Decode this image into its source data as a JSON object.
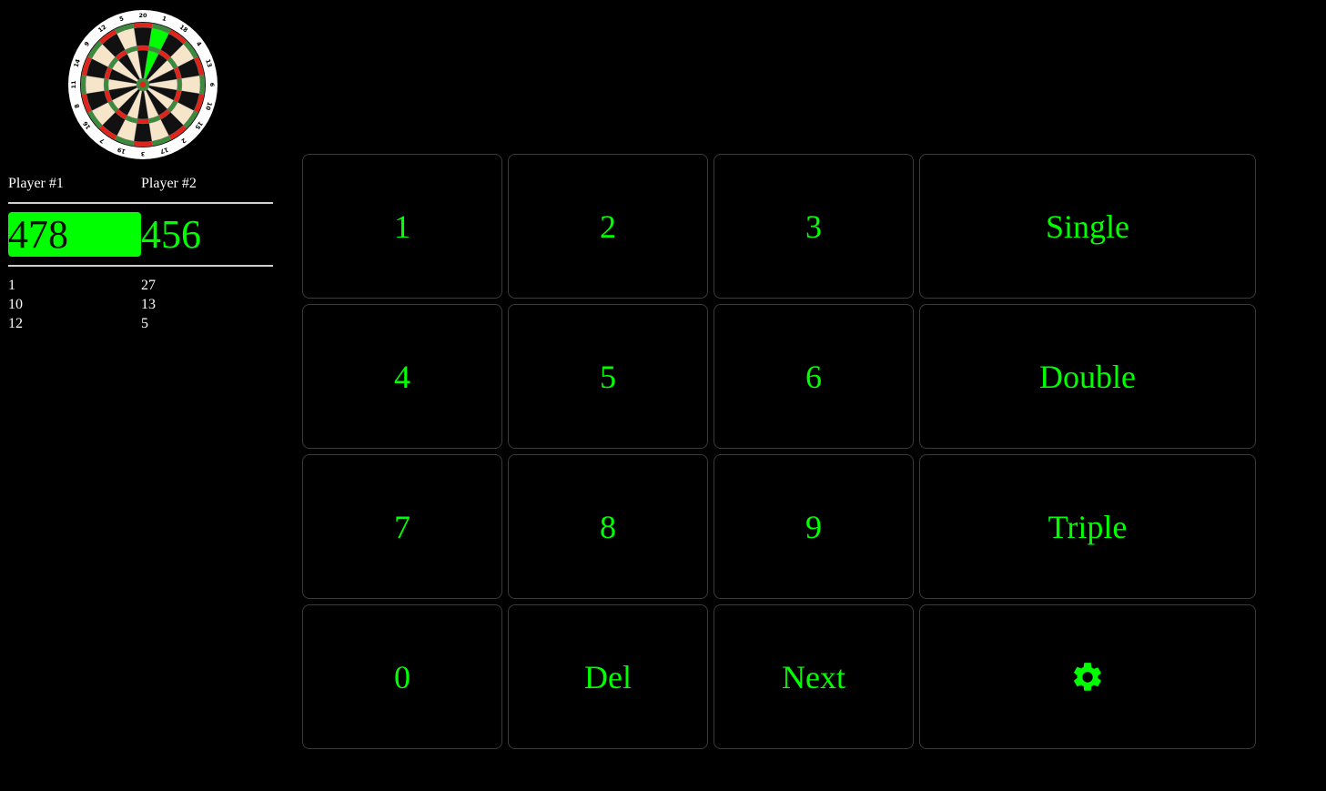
{
  "board": {
    "numbers": [
      "20",
      "1",
      "18",
      "4",
      "13",
      "6",
      "10",
      "15",
      "2",
      "17",
      "3",
      "19",
      "7",
      "16",
      "8",
      "11",
      "14",
      "9",
      "12",
      "5"
    ],
    "highlighted_segment": "1",
    "colors": {
      "dark": "#111111",
      "light": "#f6e5c8",
      "red": "#e2231a",
      "green": "#3c8a3c",
      "highlight": "#00ff00"
    }
  },
  "players": [
    {
      "name": "Player #1",
      "score": "478",
      "throws": [
        "1",
        "10",
        "12"
      ],
      "active": true
    },
    {
      "name": "Player #2",
      "score": "456",
      "throws": [
        "27",
        "13",
        "5"
      ],
      "active": false
    }
  ],
  "keypad": {
    "keys": [
      {
        "label": "1",
        "name": "key-1"
      },
      {
        "label": "2",
        "name": "key-2"
      },
      {
        "label": "3",
        "name": "key-3"
      },
      {
        "label": "Single",
        "name": "single-button"
      },
      {
        "label": "4",
        "name": "key-4"
      },
      {
        "label": "5",
        "name": "key-5"
      },
      {
        "label": "6",
        "name": "key-6"
      },
      {
        "label": "Double",
        "name": "double-button"
      },
      {
        "label": "7",
        "name": "key-7"
      },
      {
        "label": "8",
        "name": "key-8"
      },
      {
        "label": "9",
        "name": "key-9"
      },
      {
        "label": "Triple",
        "name": "triple-button"
      },
      {
        "label": "0",
        "name": "key-0"
      },
      {
        "label": "Del",
        "name": "delete-button"
      },
      {
        "label": "Next",
        "name": "next-button"
      },
      {
        "label": "",
        "name": "settings-button",
        "icon": "gear-icon"
      }
    ]
  },
  "colors": {
    "accent": "#00ff00",
    "background": "#000000",
    "key_border": "#3a3a3a",
    "text": "#ffffff"
  }
}
